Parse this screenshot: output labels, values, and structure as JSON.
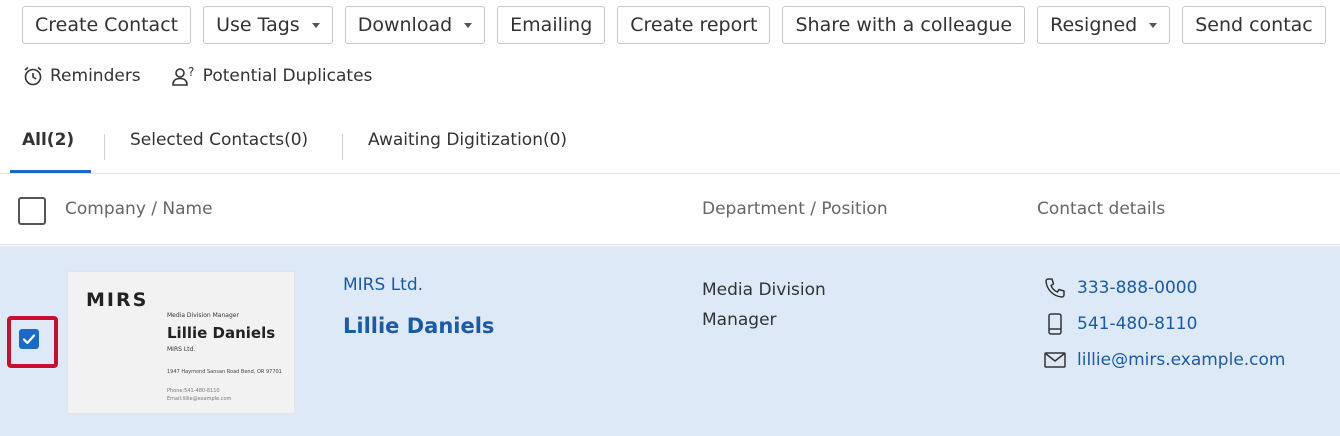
{
  "toolbar": {
    "create_contact": "Create Contact",
    "use_tags": "Use Tags",
    "download": "Download",
    "emailing": "Emailing",
    "create_report": "Create report",
    "share": "Share with a colleague",
    "resigned": "Resigned",
    "send_contact": "Send contac"
  },
  "subtools": {
    "reminders": "Reminders",
    "duplicates": "Potential Duplicates"
  },
  "tabs": {
    "all": "All(2)",
    "selected": "Selected Contacts(0)",
    "awaiting": "Awaiting Digitization(0)"
  },
  "table": {
    "col_company_name": "Company / Name",
    "col_department": "Department / Position",
    "col_contact": "Contact details"
  },
  "row": {
    "selected": true,
    "company": "MIRS Ltd.",
    "name": "Lillie Daniels",
    "department": "Media Division Manager",
    "phone": "333-888-0000",
    "mobile": "541-480-8110",
    "email": "lillie@mirs.example.com",
    "card": {
      "logo": "MIRS",
      "title": "Media Division Manager",
      "name": "Lillie Daniels",
      "company": "MIRS Ltd.",
      "address": "1947 Haymond Sansan Road Bend, OR 97701",
      "phone": "Phone:541-480-8110",
      "email": "Email:lillie@example.com"
    }
  },
  "colors": {
    "accent": "#1b6ac9",
    "link": "#1b5aa6",
    "row_selected_bg": "#dde9f6",
    "highlight_frame": "#c8102e"
  }
}
